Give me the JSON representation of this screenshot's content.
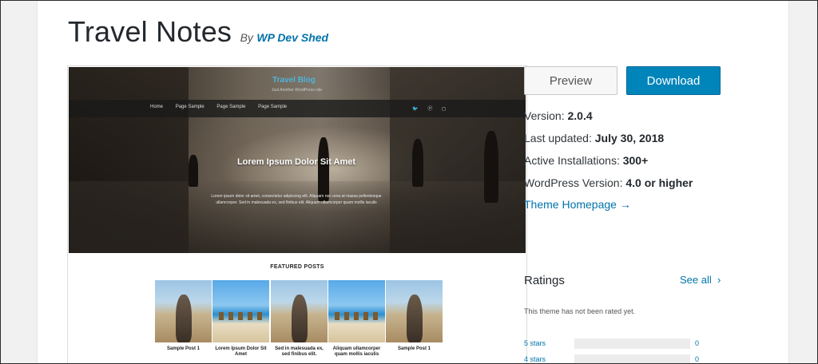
{
  "theme": {
    "title": "Travel Notes",
    "by": "By",
    "author": "WP Dev Shed"
  },
  "preview_image": {
    "site_title": "Travel Blog",
    "site_description": "Just Another WordPress site",
    "nav_items": [
      "Home",
      "Page Sample",
      "Page Sample",
      "Page Sample"
    ],
    "social_icons": [
      "twitter-icon",
      "pinterest-icon",
      "instagram-icon"
    ],
    "hero_heading": "Lorem Ipsum Dolor Sit Amet",
    "hero_text_1": "Lorem ipsum dolor sit amet, consectetur adipiscing elit. Aliquam nec urna at massa pellentesque",
    "hero_text_2": "ullamcorper. Sed in malesuada ex, sed finibus elit. Aliquam ullamcorper quam mollis iaculis",
    "featured_heading": "FEATURED POSTS",
    "posts": [
      {
        "caption": "Sample Post 1"
      },
      {
        "caption": "Lorem Ipsum Dolor Sit Amet"
      },
      {
        "caption": "Sed in malesuada ex, sed finibus elit."
      },
      {
        "caption": "Aliquam ullamcorper quam mollis iaculis"
      },
      {
        "caption": "Sample Post 1"
      }
    ]
  },
  "actions": {
    "preview_label": "Preview",
    "download_label": "Download"
  },
  "meta": {
    "version_label": "Version:",
    "version_value": "2.0.4",
    "updated_label": "Last updated:",
    "updated_value": "July 30, 2018",
    "installs_label": "Active Installations:",
    "installs_value": "300+",
    "wp_label": "WordPress Version:",
    "wp_value": "4.0 or higher",
    "homepage_label": "Theme Homepage →"
  },
  "ratings": {
    "heading": "Ratings",
    "see_all": "See all",
    "not_rated": "This theme has not been rated yet.",
    "rows": [
      {
        "label": "5 stars",
        "count": "0",
        "fraction": 0
      },
      {
        "label": "4 stars",
        "count": "0",
        "fraction": 0
      }
    ]
  },
  "colors": {
    "accent": "#0073aa",
    "download_bg": "#0085ba"
  }
}
